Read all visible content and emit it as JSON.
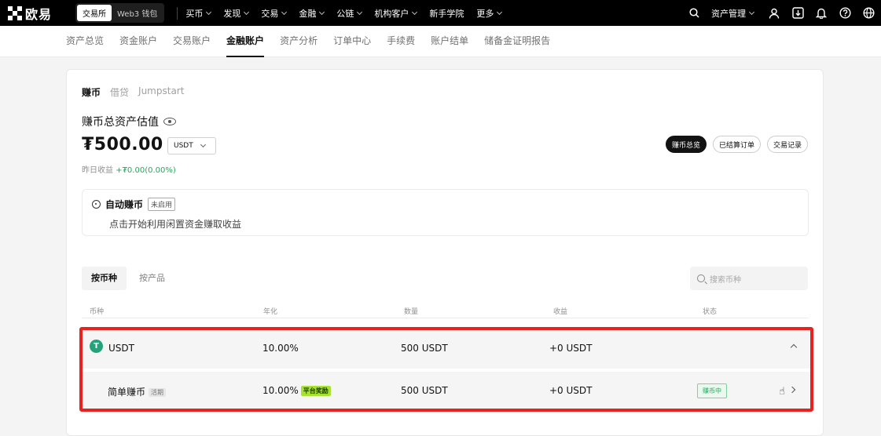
{
  "topnav": {
    "brand": "欧易",
    "mode_tabs": [
      "交易所",
      "Web3 钱包"
    ],
    "menu": [
      "买币",
      "发现",
      "交易",
      "金融",
      "公链",
      "机构客户",
      "新手学院",
      "更多"
    ],
    "asset_manage": "资产管理"
  },
  "subnav": {
    "items": [
      "资产总览",
      "资金账户",
      "交易账户",
      "金融账户",
      "资产分析",
      "订单中心",
      "手续费",
      "账户结单",
      "储备金证明报告"
    ],
    "active": "金融账户"
  },
  "panel": {
    "tabs": [
      "赚币",
      "借贷",
      "Jumpstart"
    ],
    "est_label": "赚币总资产估值",
    "amount": "₮500.00",
    "currency": "USDT",
    "yesterday_label": "昨日收益",
    "yesterday_value": "+₮0.00(0.00%)",
    "actions": [
      "赚币总览",
      "已结算订单",
      "交易记录"
    ]
  },
  "auto_earn": {
    "title": "自动赚币",
    "status": "未启用",
    "desc": "点击开始利用闲置资金赚取收益"
  },
  "filters": {
    "tabs": [
      "按币种",
      "按产品"
    ],
    "search_placeholder": "搜索币种"
  },
  "table": {
    "headers": [
      "币种",
      "年化",
      "数量",
      "收益",
      "状态"
    ],
    "coin_row": {
      "coin": "USDT",
      "apy": "10.00%",
      "amount": "500 USDT",
      "profit": "+0 USDT"
    },
    "product_row": {
      "name": "简单赚币",
      "term": "活期",
      "apy": "10.00%",
      "reward": "平台奖励",
      "amount": "500 USDT",
      "profit": "+0 USDT",
      "status": "赚币中"
    }
  },
  "colors": {
    "highlight": "#e8231f",
    "reward": "#a6e22e",
    "positive": "#26a65b"
  }
}
